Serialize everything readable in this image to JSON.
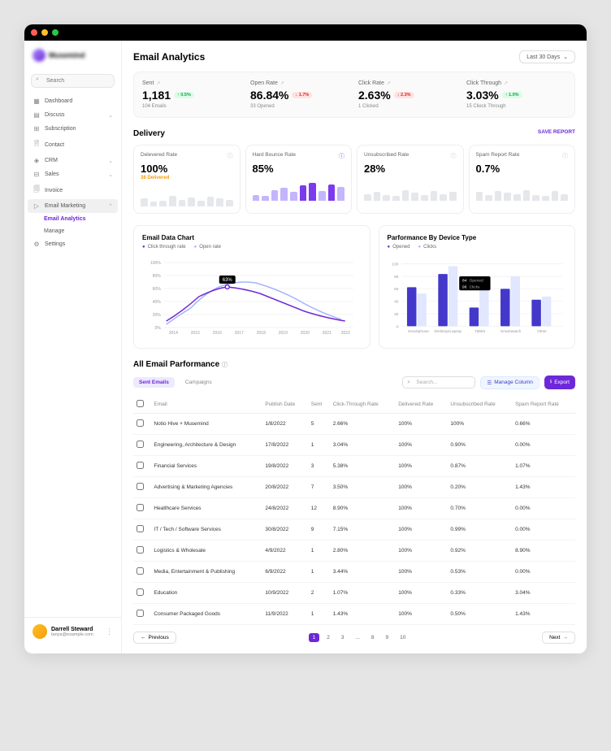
{
  "brand": "Musemind",
  "search_placeholder": "Search",
  "nav": {
    "items": [
      {
        "icon": "▦",
        "label": "Dashboard",
        "chev": ""
      },
      {
        "icon": "▤",
        "label": "Discuss",
        "chev": "⌄"
      },
      {
        "icon": "⊞",
        "label": "Subscription",
        "chev": ""
      },
      {
        "icon": "🗎",
        "label": "Contact",
        "chev": ""
      },
      {
        "icon": "◈",
        "label": "CRM",
        "chev": "⌄"
      },
      {
        "icon": "⊟",
        "label": "Sales",
        "chev": "⌄"
      },
      {
        "icon": "🗐",
        "label": "Invoice",
        "chev": ""
      },
      {
        "icon": "▷",
        "label": "Email Marketing",
        "chev": "⌃"
      }
    ],
    "sub": [
      {
        "label": "Email Analytics",
        "active": true
      },
      {
        "label": "Manage",
        "active": false
      }
    ],
    "settings": {
      "icon": "⚙",
      "label": "Settings"
    }
  },
  "user": {
    "name": "Darrell Steward",
    "email": "tanya@example.com"
  },
  "page_title": "Email Analytics",
  "date_filter": "Last 30 Days",
  "stats": [
    {
      "label": "Sent",
      "value": "1,181",
      "badge": "↑ 0.5%",
      "dir": "up",
      "sub": "104 Emails"
    },
    {
      "label": "Open Rate",
      "value": "86.84%",
      "badge": "↓ 1.7%",
      "dir": "down",
      "sub": "33 Opened"
    },
    {
      "label": "Click Rate",
      "value": "2.63%",
      "badge": "↓ 2.3%",
      "dir": "down",
      "sub": "1 Clicked"
    },
    {
      "label": "Click Through",
      "value": "3.03%",
      "badge": "↑ 1.0%",
      "dir": "up",
      "sub": "15 Clieck Through"
    }
  ],
  "delivery_title": "Delivery",
  "save_report": "SAVE REPORT",
  "delivery": [
    {
      "label": "Delevered Rate",
      "value": "100%",
      "sub": "38 Delivered",
      "style": "gray"
    },
    {
      "label": "Hard Bounce Rate",
      "value": "85%",
      "sub": "",
      "style": "purple"
    },
    {
      "label": "Unsubscribed Rate",
      "value": "28%",
      "sub": "",
      "style": "gray"
    },
    {
      "label": "Spam Report Rate",
      "value": "0.7%",
      "sub": "",
      "style": "gray"
    }
  ],
  "chart_data": [
    {
      "type": "line",
      "title": "Email Data Chart",
      "series": [
        {
          "name": "Click through rate",
          "color": "#6d28d9",
          "values": [
            10,
            25,
            50,
            65,
            63,
            60,
            52,
            40,
            28,
            15
          ]
        },
        {
          "name": "Open rate",
          "color": "#a5b4fc",
          "values": [
            5,
            20,
            45,
            70,
            80,
            72,
            55,
            38,
            22,
            10
          ]
        }
      ],
      "x": [
        "2014",
        "2015",
        "2016",
        "2017",
        "2018",
        "2019",
        "2020",
        "2021",
        "2022",
        "2022"
      ],
      "ylim": [
        0,
        100
      ],
      "yticks": [
        "0%",
        "20%",
        "40%",
        "60%",
        "80%",
        "100%"
      ],
      "annotation": "63%"
    },
    {
      "type": "bar",
      "title": "Parformance By Device Type",
      "series": [
        {
          "name": "Opened",
          "color": "#4338ca",
          "values": [
            62,
            84,
            30,
            60,
            42
          ]
        },
        {
          "name": "Clicks",
          "color": "#e0e7ff",
          "values": [
            52,
            96,
            65,
            80,
            48
          ]
        }
      ],
      "categories": [
        "Smartphone",
        "Desktop/Laptop",
        "Tablet",
        "Smartwatch",
        "Other"
      ],
      "ylim": [
        0,
        100
      ],
      "yticks": [
        "0",
        "20",
        "40",
        "60",
        "80",
        "100"
      ],
      "annotation": {
        "opened": "84 Opened",
        "clicks": "96 Clicks"
      }
    }
  ],
  "table_title": "All Email Parformance",
  "tabs": {
    "sent": "Sent Emails",
    "camp": "Campaigns"
  },
  "table_search": "Search...",
  "manage_col": "Manage Column",
  "export": "Export",
  "columns": [
    "Email",
    "Publish Date",
    "Sent",
    "Click-Through Rate",
    "Delivered Rate",
    "Unsubscribed Rate",
    "Spam Report Rate"
  ],
  "rows": [
    [
      "Notio Hive + Musemind",
      "1/8/2022",
      "5",
      "2.66%",
      "100%",
      "100%",
      "0.66%"
    ],
    [
      "Engineering, Architecture & Design",
      "17/8/2022",
      "1",
      "3.04%",
      "100%",
      "0.90%",
      "0.00%"
    ],
    [
      "Financial Services",
      "19/8/2022",
      "3",
      "5.38%",
      "100%",
      "0.87%",
      "1.07%"
    ],
    [
      "Advertising & Marketing Agencies",
      "20/8/2022",
      "7",
      "3.50%",
      "100%",
      "0.20%",
      "1.43%"
    ],
    [
      "Healthcare Services",
      "24/8/2022",
      "12",
      "8.90%",
      "100%",
      "0.70%",
      "0.00%"
    ],
    [
      "IT / Tech / Software Services",
      "30/8/2022",
      "9",
      "7.15%",
      "100%",
      "0.99%",
      "0.00%"
    ],
    [
      "Logistics & Wholesale",
      "4/9/2022",
      "1",
      "2.80%",
      "100%",
      "0.92%",
      "8.90%"
    ],
    [
      "Media, Entertainment & Publishing",
      "6/9/2022",
      "1",
      "3.44%",
      "100%",
      "0.53%",
      "0.00%"
    ],
    [
      "Education",
      "10/9/2022",
      "2",
      "1.07%",
      "100%",
      "0.33%",
      "3.04%"
    ],
    [
      "Consumer Packaged Goods",
      "11/9/2022",
      "1",
      "1.43%",
      "100%",
      "0.50%",
      "1.43%"
    ]
  ],
  "pagination": {
    "prev": "Previous",
    "next": "Next",
    "pages": [
      "1",
      "2",
      "3",
      "...",
      "8",
      "9",
      "10"
    ]
  }
}
